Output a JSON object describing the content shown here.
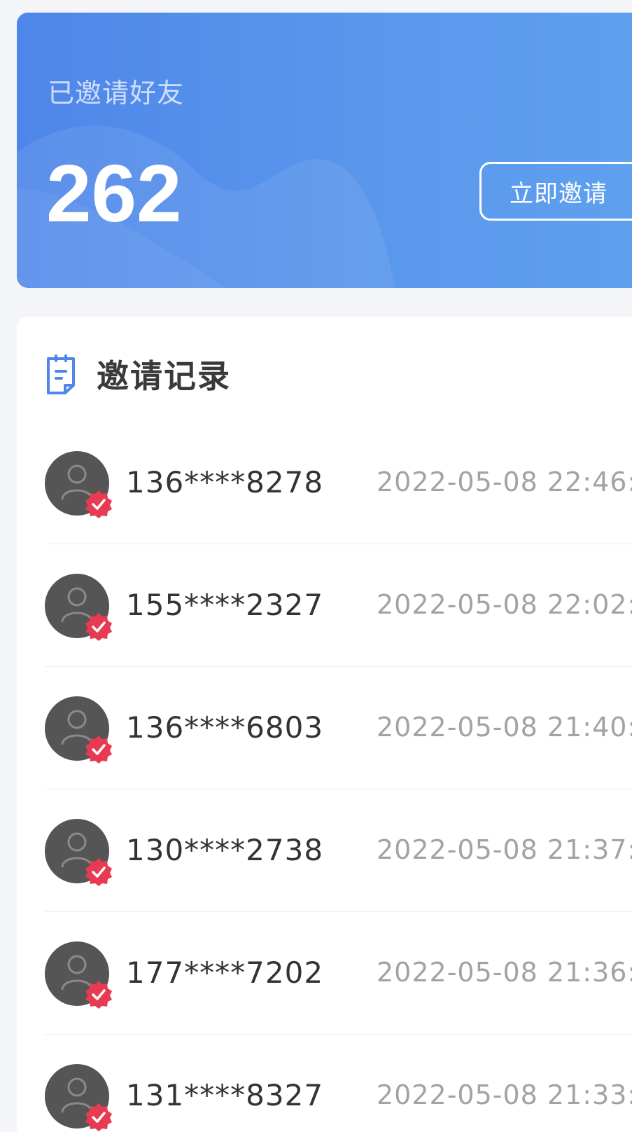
{
  "summary": {
    "label": "已邀请好友",
    "count": "262",
    "invite_button_label": "立即邀请"
  },
  "records": {
    "title": "邀请记录",
    "items": [
      {
        "phone": "136****8278",
        "time": "2022-05-08 22:46:"
      },
      {
        "phone": "155****2327",
        "time": "2022-05-08 22:02:"
      },
      {
        "phone": "136****6803",
        "time": "2022-05-08 21:40:"
      },
      {
        "phone": "130****2738",
        "time": "2022-05-08 21:37:"
      },
      {
        "phone": "177****7202",
        "time": "2022-05-08 21:36:"
      },
      {
        "phone": "131****8327",
        "time": "2022-05-08 21:33:"
      }
    ]
  },
  "icons": {
    "records": "clipboard-list-icon",
    "avatar": "user-icon",
    "badge": "verified-check-icon"
  },
  "colors": {
    "brand_blue": "#5290eb",
    "badge_red": "#e63b53",
    "avatar_gray": "#555555"
  }
}
